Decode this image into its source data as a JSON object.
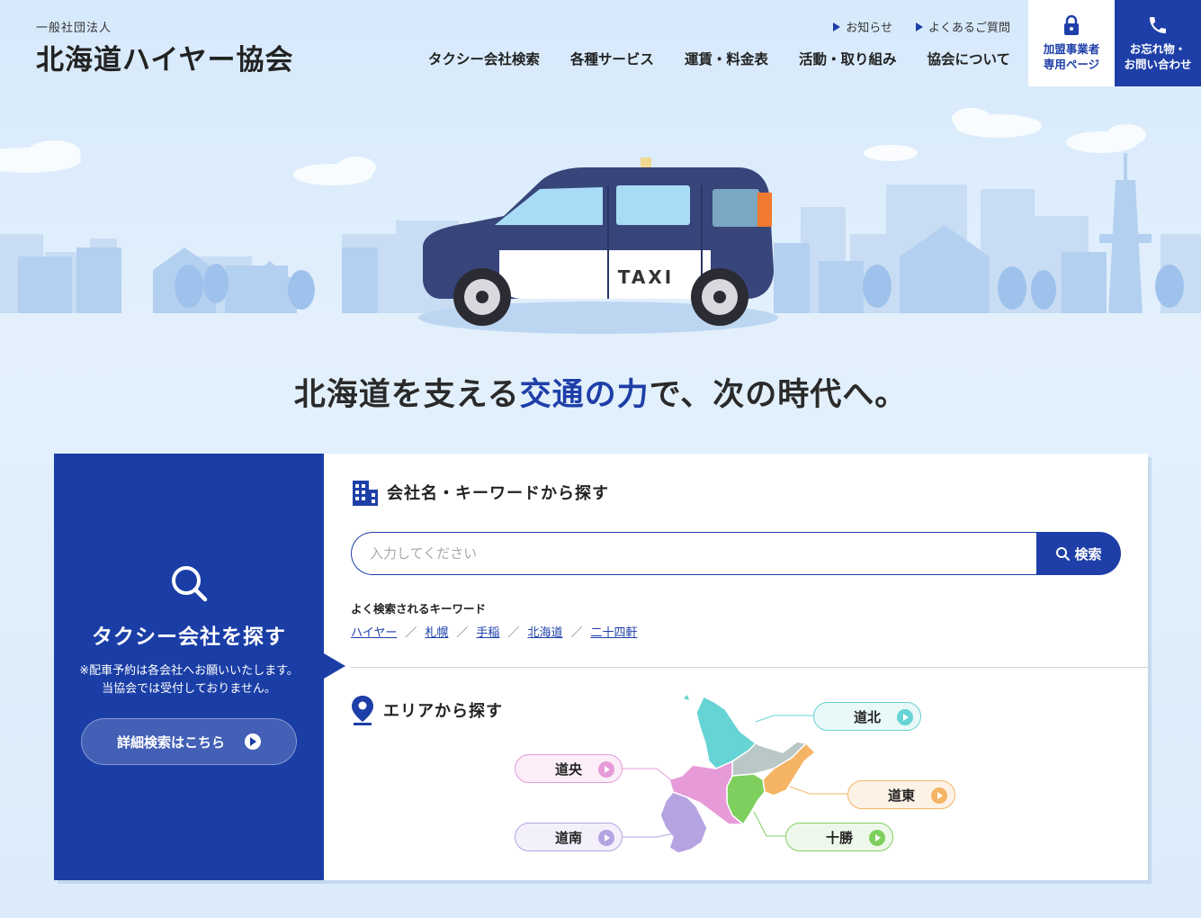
{
  "header": {
    "logo_sub": "一般社団法人",
    "logo_main": "北海道ハイヤー協会",
    "util_links": [
      "お知らせ",
      "よくあるご質問"
    ],
    "nav": [
      "タクシー会社検索",
      "各種サービス",
      "運賃・料金表",
      "活動・取り組み",
      "協会について"
    ],
    "member_btn": [
      "加盟事業者",
      "専用ページ"
    ],
    "contact_btn": [
      "お忘れ物・",
      "お問い合わせ"
    ]
  },
  "hero": {
    "taxi_sign": "TAXI",
    "headline_before": "北海道を支える",
    "headline_accent": "交通の力",
    "headline_after": "で、次の時代へ。"
  },
  "search": {
    "left_title": "タクシー会社を探す",
    "left_note_line1": "※配車予約は各会社へお願いいたします。",
    "left_note_line2": "当協会では受付しておりません。",
    "detail_button": "詳細検索はこちら",
    "keyword_title": "会社名・キーワードから探す",
    "placeholder": "入力してください",
    "search_button": "検索",
    "popular_label": "よく検索されるキーワード",
    "popular_keywords": [
      "ハイヤー",
      "札幌",
      "手稲",
      "北海道",
      "二十四軒"
    ],
    "area_title": "エリアから探す",
    "regions": {
      "north": "道北",
      "central": "道央",
      "east": "道東",
      "south": "道南",
      "tokachi": "十勝"
    }
  },
  "colors": {
    "brand": "#1e3fa8",
    "north": "#66d3d4",
    "central": "#e79ad8",
    "east": "#f5b464",
    "south": "#b5a3e2",
    "tokachi": "#7fcf5f",
    "okhotsk": "#b9c7c6"
  }
}
